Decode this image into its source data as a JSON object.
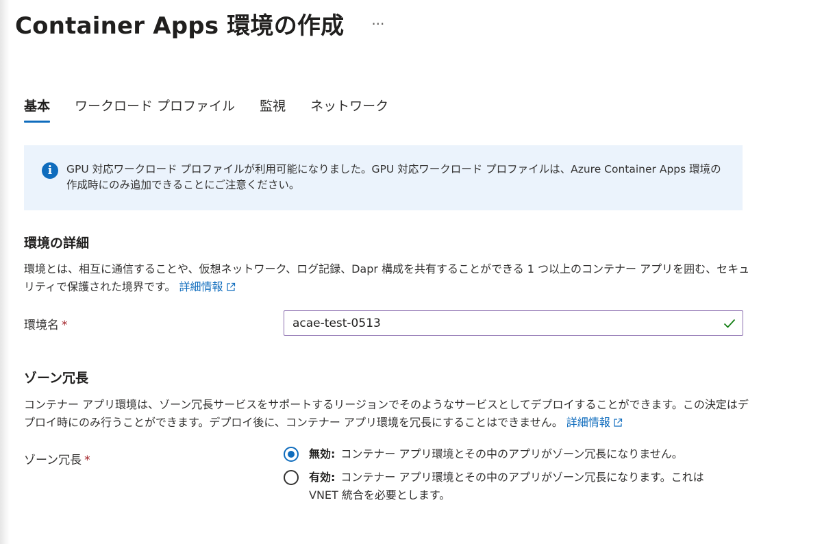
{
  "page": {
    "title": "Container Apps 環境の作成",
    "more_label": "···"
  },
  "tabs": [
    {
      "label": "基本",
      "active": true
    },
    {
      "label": "ワークロード プロファイル",
      "active": false
    },
    {
      "label": "監視",
      "active": false
    },
    {
      "label": "ネットワーク",
      "active": false
    }
  ],
  "info_banner": {
    "icon": "info-icon",
    "text": "GPU 対応ワークロード プロファイルが利用可能になりました。GPU 対応ワークロード プロファイルは、Azure Container Apps 環境の作成時にのみ追加できることにご注意ください。"
  },
  "environment_details": {
    "heading": "環境の詳細",
    "description": "環境とは、相互に通信することや、仮想ネットワーク、ログ記録、Dapr 構成を共有することができる 1 つ以上のコンテナー アプリを囲む、セキュリティで保護された境界です。",
    "learn_more": "詳細情報",
    "name_label": "環境名",
    "required_mark": "*",
    "name_value": "acae-test-0513"
  },
  "zone_redundancy": {
    "heading": "ゾーン冗長",
    "description": "コンテナー アプリ環境は、ゾーン冗長サービスをサポートするリージョンでそのようなサービスとしてデプロイすることができます。この決定はデプロイ時にのみ行うことができます。デプロイ後に、コンテナー アプリ環境を冗長にすることはできません。",
    "learn_more": "詳細情報",
    "field_label": "ゾーン冗長",
    "required_mark": "*",
    "options": [
      {
        "label": "無効:",
        "description": "コンテナー アプリ環境とその中のアプリがゾーン冗長になりません。",
        "selected": true
      },
      {
        "label": "有効:",
        "description": "コンテナー アプリ環境とその中のアプリがゾーン冗長になります。これは VNET 統合を必要とします。",
        "selected": false
      }
    ]
  },
  "colors": {
    "accent": "#0f6cbd",
    "banner_background": "#ebf3fc",
    "required": "#a4262c",
    "valid_check": "#107c10",
    "input_border": "#8a6cae"
  }
}
